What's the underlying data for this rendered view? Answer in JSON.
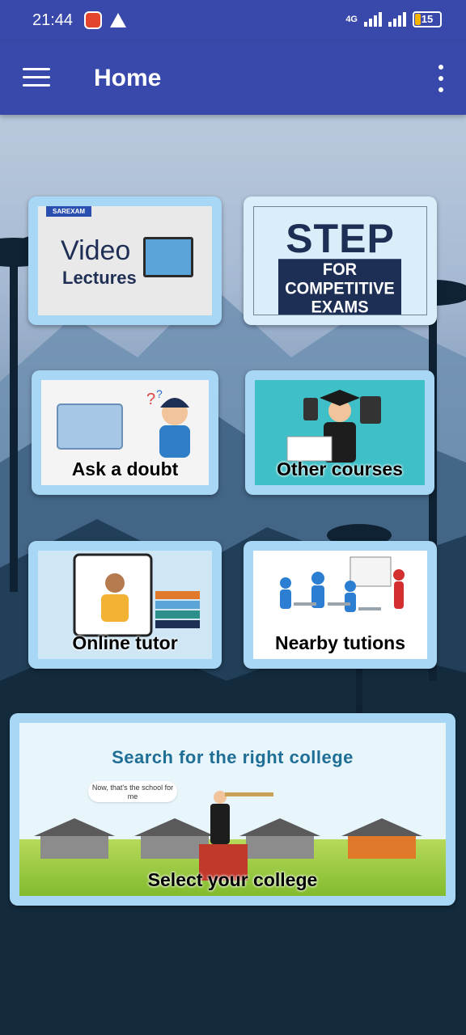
{
  "status_bar": {
    "time": "21:44",
    "network": "4G",
    "battery": "15"
  },
  "app_bar": {
    "title": "Home"
  },
  "tiles": {
    "video": {
      "brand": "SAREXAM",
      "title": "Video",
      "subtitle": "Lectures"
    },
    "step": {
      "title": "STEP",
      "line1": "FOR COMPETITIVE",
      "line2": "EXAMS"
    },
    "doubt": {
      "label": "Ask a doubt"
    },
    "other": {
      "label": "Other courses"
    },
    "online": {
      "label": "Online tutor"
    },
    "nearby": {
      "label": "Nearby tutions"
    },
    "college": {
      "heading": "Search for the right college",
      "bubble": "Now, that's the school for me",
      "label": "Select your college"
    }
  },
  "colors": {
    "primary": "#3949ab",
    "tile_border": "#a8d6f5",
    "step_navy": "#1d2f55"
  }
}
